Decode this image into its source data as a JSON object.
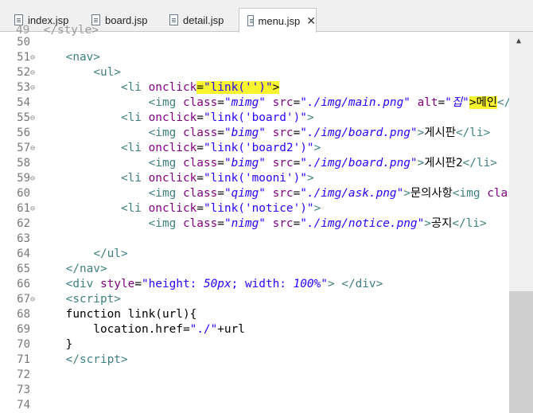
{
  "tabs": [
    {
      "label": "index.jsp",
      "active": false
    },
    {
      "label": "board.jsp",
      "active": false
    },
    {
      "label": "detail.jsp",
      "active": false
    },
    {
      "label": "menu.jsp",
      "active": true
    }
  ],
  "close_glyph": "✕",
  "lines": [
    {
      "n": "50",
      "fold": false,
      "html": ""
    },
    {
      "n": "51",
      "fold": true,
      "html": "    <span class='kw-tag'>&lt;nav&gt;</span>"
    },
    {
      "n": "52",
      "fold": true,
      "html": "        <span class='kw-tag'>&lt;ul&gt;</span>"
    },
    {
      "n": "53",
      "fold": true,
      "html": "            <span class='kw-tag'>&lt;li</span> <span class='attr'>onclick</span><span class='hl'>=<span class='str'>\"link('')\"</span>&gt;</span>"
    },
    {
      "n": "54",
      "fold": false,
      "html": "                <span class='kw-tag'>&lt;img</span> <span class='attr'>class</span>=<span class='stri'>\"mimg\"</span> <span class='attr'>src</span>=<span class='stri'>\"./img/main.png\"</span> <span class='attr'>alt</span>=<span class='stri'>\"집\"</span><span class='hl'>&gt;메인</span><span class='kw-tag'>&lt;/li&gt;</span>"
    },
    {
      "n": "55",
      "fold": true,
      "html": "            <span class='kw-tag'>&lt;li</span> <span class='attr'>onclick</span>=<span class='str'>\"link('board')\"</span><span class='kw-tag'>&gt;</span>"
    },
    {
      "n": "56",
      "fold": false,
      "html": "                <span class='kw-tag'>&lt;img</span> <span class='attr'>class</span>=<span class='stri'>\"bimg\"</span> <span class='attr'>src</span>=<span class='stri'>\"./img/board.png\"</span><span class='kw-tag'>&gt;</span>게시판<span class='kw-tag'>&lt;/li&gt;</span>"
    },
    {
      "n": "57",
      "fold": true,
      "html": "            <span class='kw-tag'>&lt;li</span> <span class='attr'>onclick</span>=<span class='str'>\"link('board2')\"</span><span class='kw-tag'>&gt;</span>"
    },
    {
      "n": "58",
      "fold": false,
      "html": "                <span class='kw-tag'>&lt;img</span> <span class='attr'>class</span>=<span class='stri'>\"bimg\"</span> <span class='attr'>src</span>=<span class='stri'>\"./img/board.png\"</span><span class='kw-tag'>&gt;</span>게시판2<span class='kw-tag'>&lt;/li&gt;</span>"
    },
    {
      "n": "59",
      "fold": true,
      "html": "            <span class='kw-tag'>&lt;li</span> <span class='attr'>onclick</span>=<span class='str'>\"link('mooni')\"</span><span class='kw-tag'>&gt;</span>"
    },
    {
      "n": "60",
      "fold": false,
      "html": "                <span class='kw-tag'>&lt;img</span> <span class='attr'>class</span>=<span class='stri'>\"qimg\"</span> <span class='attr'>src</span>=<span class='stri'>\"./img/ask.png\"</span><span class='kw-tag'>&gt;</span>문의사항<span class='kw-tag'>&lt;img</span> <span class='attr'>class</span>=<span class='str'>\"</span>"
    },
    {
      "n": "61",
      "fold": true,
      "html": "            <span class='kw-tag'>&lt;li</span> <span class='attr'>onclick</span>=<span class='str'>\"link('notice')\"</span><span class='kw-tag'>&gt;</span>"
    },
    {
      "n": "62",
      "fold": false,
      "html": "                <span class='kw-tag'>&lt;img</span> <span class='attr'>class</span>=<span class='stri'>\"nimg\"</span> <span class='attr'>src</span>=<span class='stri'>\"./img/notice.png\"</span><span class='kw-tag'>&gt;</span>공지<span class='kw-tag'>&lt;/li&gt;</span>"
    },
    {
      "n": "63",
      "fold": false,
      "html": ""
    },
    {
      "n": "64",
      "fold": false,
      "html": "        <span class='kw-tag'>&lt;/ul&gt;</span>"
    },
    {
      "n": "65",
      "fold": false,
      "html": "    <span class='kw-tag'>&lt;/nav&gt;</span>"
    },
    {
      "n": "66",
      "fold": false,
      "html": "    <span class='kw-tag'>&lt;div</span> <span class='attr'>style</span>=<span class='str'>\"height: <i>50px</i>; width: <i>100%</i>\"</span><span class='kw-tag'>&gt;</span> <span class='kw-tag'>&lt;/div&gt;</span>"
    },
    {
      "n": "67",
      "fold": true,
      "html": "    <span class='kw-tag'>&lt;script&gt;</span>"
    },
    {
      "n": "68",
      "fold": false,
      "html": "    function link(url){"
    },
    {
      "n": "69",
      "fold": false,
      "html": "        location.href=<span class='str'>\"./\"</span>+url"
    },
    {
      "n": "70",
      "fold": false,
      "html": "    }"
    },
    {
      "n": "71",
      "fold": false,
      "html": "    <span class='kw-tag'>&lt;/script&gt;</span>"
    },
    {
      "n": "72",
      "fold": false,
      "html": ""
    },
    {
      "n": "73",
      "fold": false,
      "html": ""
    },
    {
      "n": "74",
      "fold": false,
      "html": ""
    }
  ],
  "partial_top_line": "49  </style>"
}
